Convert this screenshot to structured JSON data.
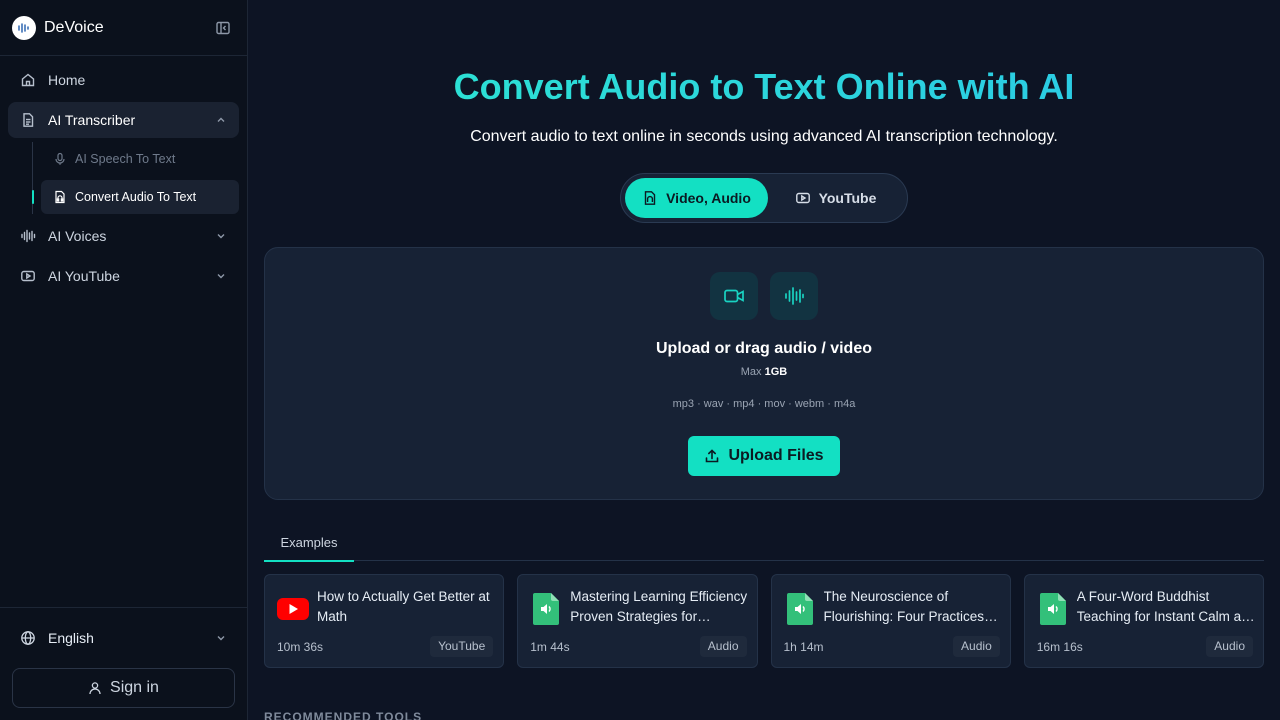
{
  "app": {
    "name": "DeVoice"
  },
  "sidebar": {
    "items": [
      {
        "label": "Home",
        "icon": "home-icon"
      },
      {
        "label": "AI Transcriber",
        "icon": "document-icon",
        "expanded": true,
        "children": [
          {
            "label": "AI Speech To Text",
            "icon": "microphone-icon"
          },
          {
            "label": "Convert Audio To Text",
            "icon": "audio-file-icon",
            "active": true
          }
        ]
      },
      {
        "label": "AI Voices",
        "icon": "waveform-icon"
      },
      {
        "label": "AI YouTube",
        "icon": "youtube-icon"
      }
    ],
    "language": "English",
    "signin": "Sign in"
  },
  "hero": {
    "title": "Convert Audio to Text Online with AI",
    "subtitle": "Convert audio to text online in seconds using advanced AI transcription technology."
  },
  "toggle": {
    "option1": "Video, Audio",
    "option2": "YouTube",
    "selected": "Video, Audio"
  },
  "upload": {
    "title": "Upload or drag audio / video",
    "max_label": "Max",
    "max_value": "1GB",
    "formats": "mp3 · wav · mp4 · mov · webm · m4a",
    "button": "Upload Files"
  },
  "examples": {
    "tab": "Examples",
    "cards": [
      {
        "title": "How to Actually Get Better at Math",
        "duration": "10m 36s",
        "badge": "YouTube",
        "type": "youtube"
      },
      {
        "title": "Mastering Learning Efficiency Proven Strategies for Success",
        "duration": "1m 44s",
        "badge": "Audio",
        "type": "audio"
      },
      {
        "title": "The Neuroscience of Flourishing: Four Practices for Wellbeing",
        "duration": "1h 14m",
        "badge": "Audio",
        "type": "audio"
      },
      {
        "title": "A Four-Word Buddhist Teaching for Instant Calm and Clarity",
        "duration": "16m 16s",
        "badge": "Audio",
        "type": "audio"
      }
    ]
  },
  "recommended": {
    "heading": "RECOMMENDED TOOLS"
  },
  "colors": {
    "accent": "#13e0c3",
    "background": "#0d1424",
    "sidebar": "#0b111c",
    "card": "#172235",
    "youtube": "#ff0000",
    "audio_file": "#33c07a"
  }
}
